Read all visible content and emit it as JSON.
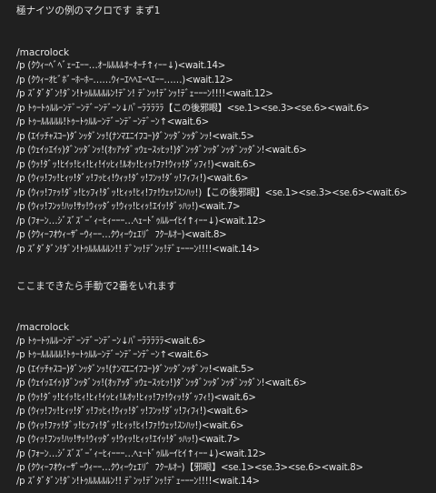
{
  "colors": {
    "background": "#202020",
    "text": "#e6e6e6"
  },
  "title": "極ナイツの例のマクロです まず1",
  "block1": {
    "header": "/macrolock",
    "lines": [
      "/p (ｸｳｨｰﾍﾞﾍﾞｪｰｴｰｰ…ｵｰﾙﾙﾙﾙｵｰｵｰﾁ↑ｨｰｰ↓)<wait.14>",
      "/p (ｸｳｨｰｵﾋﾞﾎﾞｰﾎｰﾎｰ……ｳｨｰｴﾍﾍｴｰﾍｴｰｰ……)<wait.12>",
      "/p ｽﾞﾀﾞﾀﾞﾝ!ﾀﾞﾝ!ﾄｩﾙﾙﾙﾙﾙﾝ!ﾃﾞﾝ! ﾃﾞﾝｯ!ﾃﾞﾝｯ!ﾃﾞｪｰｰｰﾝ!!!!<wait.12>",
      "/p ﾄｩｰﾄｩﾙﾙｰﾝﾃﾞｰﾝﾃﾞｰﾝﾃﾞｰﾝ↓ﾊﾟｰﾗﾗﾗﾗﾗ【この後邪眼】<se.1><se.3><se.6><wait.6>",
      "/p ﾄｩｰﾙﾙﾙﾙﾙ!ﾄｩｰﾄｩﾙﾙｰﾝﾃﾞｰﾝﾃﾞｰﾝﾃﾞｰﾝ↑<wait.6>",
      "/p (ｴｲｯﾁｬｽｺｰ)ﾀﾞﾝｯﾀﾞﾝｯ!(ﾅﾝﾏｴﾆｲﾌｺｰ)ﾀﾞﾝｯﾀﾞﾝｯﾀﾞﾝｯ!<wait.5>",
      "/p (ｳｪｲｯｴｲｯ)ﾀﾞﾝｯﾀﾞﾝｯ!(ｵｯｱｯﾀﾞｯｳｪｰｽｯﾋｯ!)ﾀﾞﾝｯﾀﾞﾝｯﾀﾞﾝｯﾀﾞﾝｯﾀﾞﾝ!<wait.6>",
      "/p (ｳｯ!ﾀﾞｯ!ﾋｲｯ!ﾋｨ!ﾋｨ!ｲｯﾋｨ!ﾙｵｯ!ﾋｨｯ!ﾌｧ!ｳｨｯ!ﾀﾞｯﾌｨ!)<wait.6>",
      "/p (ｳｨｯ!ﾌｯ!ﾋｨｯ!ﾀﾞｯ!ﾌｯﾋｨ!ｳｨｯ!ﾀﾞｯ!ﾌﾝｯ!ﾀﾞｯ!ﾌｨﾌｨ!)<wait.6>",
      "/p (ｳｨｯ!ﾌｧｯ!ﾀﾞｯ!ﾋｯﾌｨ!ﾀﾞｯ!ﾋｨｯ!ﾋｨ!ﾌｧ!ｳｪｯ!ｽﾝﾊｯ!)【この後邪眼】<se.1><se.3><se.6><wait.6>",
      "/p (ｳｨｯ!ﾌﾝｯ!ﾊｯ!ｻｯ!ｳｨｯﾀﾞｯ!ｳｨｯ!ﾋｨｯ!ｴｲｯ!ﾀﾞｯﾊｯ!)<wait.7>",
      "/p (ﾌｫｰﾝ…ｼﾞｽﾞｽﾞｰﾞｨｰﾋｨｰｰｰ…ﾍｪｰﾄﾞｩﾙﾙｰｲﾋｲ↑ｨｰｰ↓)<wait.12>",
      "/p (ｸｳｨｰﾌｵｳｨｰｻﾞｰｳｨｰｰ…ｸｳｨｰｳｪｴﾘ゛ﾌｸｰﾙｵｰ)<wait.8>",
      "/p ｽﾞﾀﾞﾀﾞﾝ!ﾀﾞﾝ!ﾄｩﾙﾙﾙﾙﾙﾝ!! ﾃﾞﾝｯ!ﾃﾞﾝｯ!ﾃﾞｪｰｰｰﾝ!!!!<wait.14>"
    ]
  },
  "note": "ここまできたら手動で2番をいれます",
  "block2": {
    "header": "/macrolock",
    "lines": [
      "/p ﾄｩｰﾄｩﾙﾙｰﾝﾃﾞｰﾝﾃﾞｰﾝﾃﾞｰﾝ↓ﾊﾟｰﾗﾗﾗﾗﾗ<wait.6>",
      "/p ﾄｩｰﾙﾙﾙﾙﾙ!ﾄｩｰﾄｩﾙﾙｰﾝﾃﾞｰﾝﾃﾞｰﾝﾃﾞｰﾝ↑<wait.6>",
      "/p (ｴｲｯﾁｬｽｺｰ)ﾀﾞﾝｯﾀﾞﾝｯ!(ﾅﾝﾏｴﾆｲﾌｺｰ)ﾀﾞﾝｯﾀﾞﾝｯﾀﾞﾝｯ!<wait.5>",
      "/p (ｳｪｲｯｴｲｯ)ﾀﾞﾝｯﾀﾞﾝｯ!(ｵｯｱｯﾀﾞｯｳｪｰｽｯﾋｯ!)ﾀﾞﾝｯﾀﾞﾝｯﾀﾞﾝｯﾀﾞﾝｯﾀﾞﾝ!<wait.6>",
      "/p (ｳｯ!ﾀﾞｯ!ﾋｲｯ!ﾋｨ!ﾋｨ!ｲｯﾋｨ!ﾙｵｯ!ﾋｨｯ!ﾌｧ!ｳｨｯ!ﾀﾞｯﾌｨ!)<wait.6>",
      "/p (ｳｨｯ!ﾌｯ!ﾋｨｯ!ﾀﾞｯ!ﾌｯﾋｨ!ｳｨｯ!ﾀﾞｯ!ﾌﾝｯ!ﾀﾞｯ!ﾌｨﾌｨ!)<wait.6>",
      "/p (ｳｨｯ!ﾌｧｯ!ﾀﾞｯ!ﾋｯﾌｨ!ﾀﾞｯ!ﾋｨｯ!ﾋｨ!ﾌｧ!ｳｪｯ!ｽﾝﾊｯ!)<wait.6>",
      "/p (ｳｨｯ!ﾌﾝｯ!ﾊｯ!ｻｯ!ｳｨｯﾀﾞｯ!ｳｨｯ!ﾋｨｯ!ｴｲｯ!ﾀﾞｯﾊｯ!)<wait.7>",
      "/p (ﾌｫｰﾝ…ｼﾞｽﾞｽﾞｰﾞｨｰﾋｨｰｰｰ…ﾍｪｰﾄﾞｩﾙﾙｰｲﾋｲ↑ｨｰｰ↓)<wait.12>",
      "/p (ｸｳｨｰﾌｵｳｨｰｻﾞｰｳｨｰｰ…ｸｳｨｰｳｪｴﾘ゛ﾌｸｰﾙｵｰ)【邪眼】<se.1><se.3><se.6><wait.8>",
      "/p ｽﾞﾀﾞﾀﾞﾝ!ﾀﾞﾝ!ﾄｩﾙﾙﾙﾙﾙﾝ!! ﾃﾞﾝｯ!ﾃﾞﾝｯ!ﾃﾞｪｰｰｰﾝ!!!!<wait.14>"
    ]
  }
}
